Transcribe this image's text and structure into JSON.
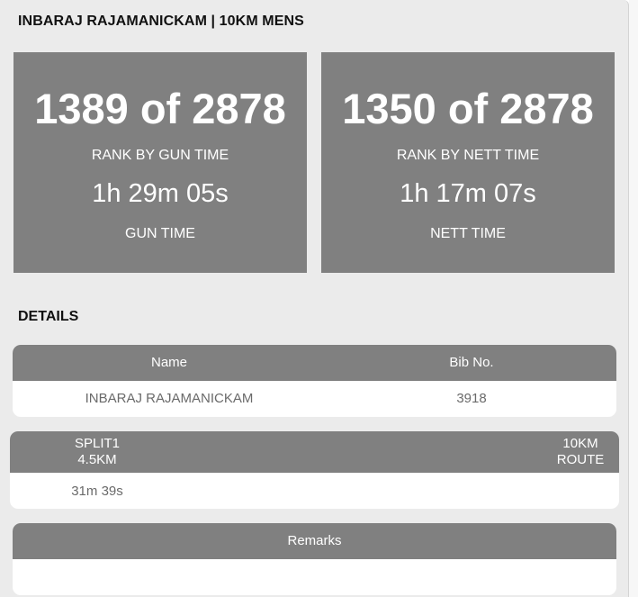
{
  "header": {
    "title": "INBARAJ RAJAMANICKAM | 10KM MENS"
  },
  "stats": {
    "gun": {
      "rank": "1389 of 2878",
      "rank_label": "RANK BY GUN TIME",
      "time": "1h 29m 05s",
      "time_label": "GUN TIME"
    },
    "nett": {
      "rank": "1350 of 2878",
      "rank_label": "RANK BY NETT TIME",
      "time": "1h 17m 07s",
      "time_label": "NETT TIME"
    }
  },
  "details": {
    "section_title": "DETAILS",
    "headers": [
      "Name",
      "Bib No."
    ],
    "row": [
      "INBARAJ RAJAMANICKAM",
      "3918"
    ]
  },
  "splits": {
    "headers": [
      {
        "line1": "SPLIT1",
        "line2": "4.5KM"
      },
      {
        "line1": "10KM",
        "line2": "ROUTE"
      }
    ],
    "row": [
      "31m 39s",
      ""
    ]
  },
  "remarks": {
    "header": "Remarks",
    "value": ""
  },
  "colors": {
    "card_bg": "#808080",
    "panel_bg": "#ebebeb",
    "text_on_card": "#ffffff",
    "cell_text": "#6a6a6a"
  }
}
